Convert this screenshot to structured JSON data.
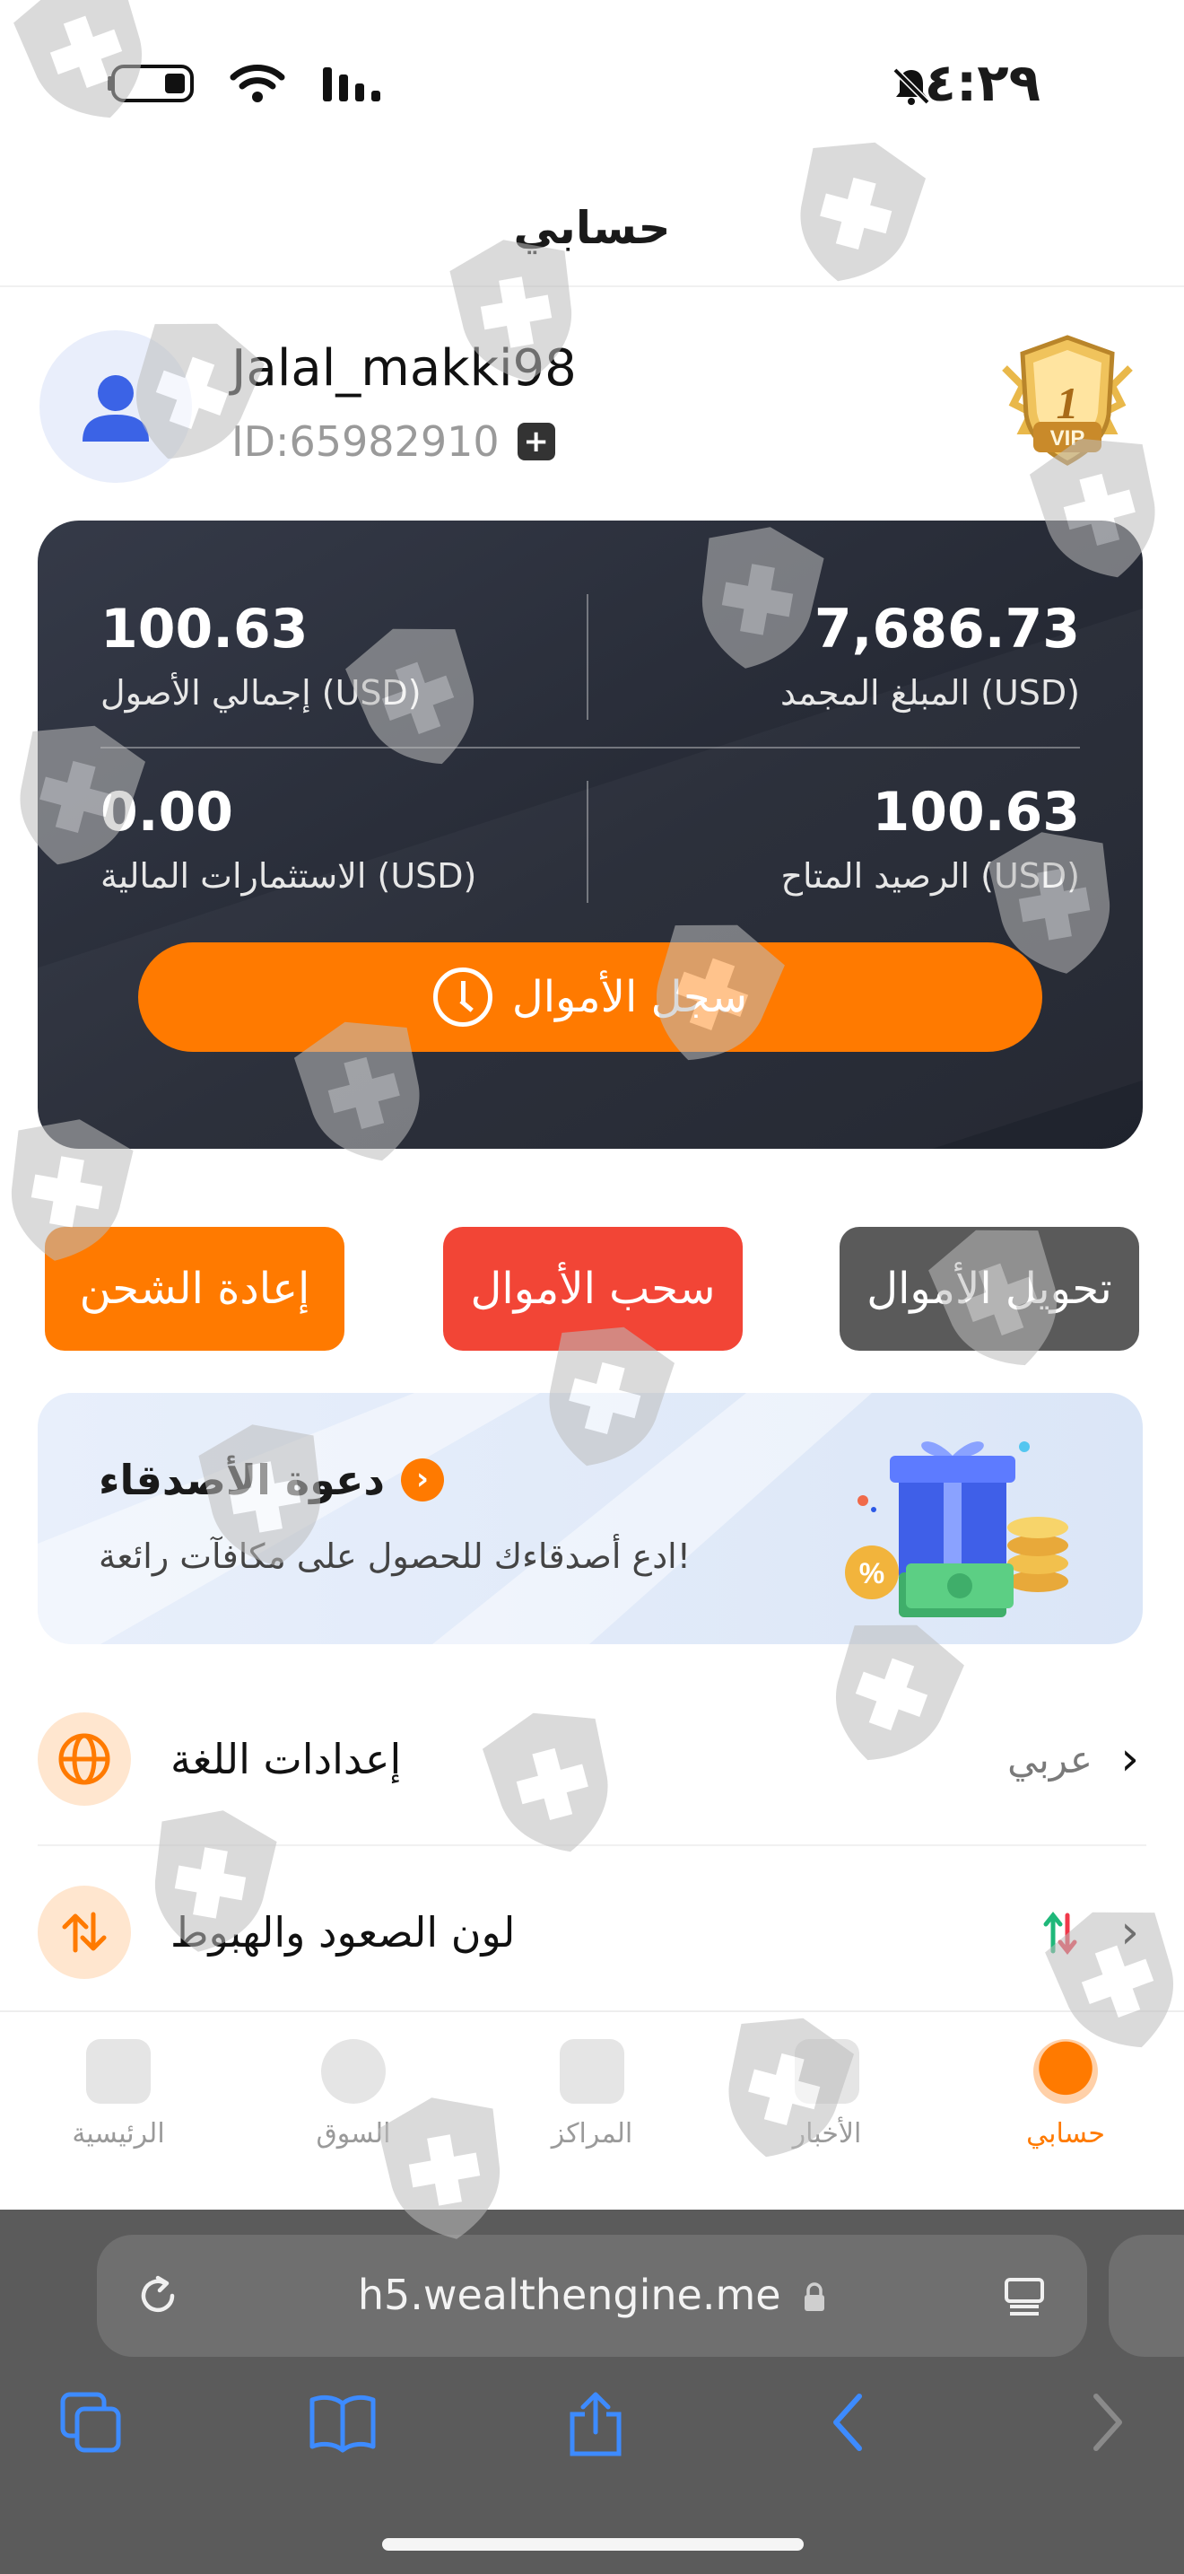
{
  "status_bar": {
    "time": "٤:٢٩"
  },
  "header": {
    "title": "حسابي"
  },
  "profile": {
    "username": "Jalal_makki98",
    "user_id": "ID:65982910",
    "vip_level": "1",
    "vip_text": "VIP"
  },
  "balance_card": {
    "total_assets": {
      "value": "100.63",
      "label": "إجمالي الأصول  (USD)"
    },
    "frozen_amount": {
      "value": "7,686.73",
      "label": "المبلغ المجمد  (USD)"
    },
    "financial_investments": {
      "value": "0.00",
      "label": "الاستثمارات المالية  (USD)"
    },
    "available_balance": {
      "value": "100.63",
      "label": "الرصيد المتاح  (USD)"
    },
    "fund_record_label": "سجل الأموال"
  },
  "actions": {
    "recharge": "إعادة الشحن",
    "withdraw": "سحب الأموال",
    "transfer": "تحويل الأموال"
  },
  "invite": {
    "title": "دعوة الأصدقاء",
    "subtitle": "ادع أصدقاءك للحصول على مكافآت رائعة!"
  },
  "settings": {
    "language": {
      "label": "إعدادات اللغة",
      "value": "عربي"
    },
    "updown_color": {
      "label": "لون الصعود والهبوط"
    }
  },
  "tabbar": {
    "home": "الرئيسية",
    "market": "السوق",
    "positions": "المراكز",
    "news": "الأخبار",
    "account": "حسابي",
    "active": "account"
  },
  "browser": {
    "url": "h5.wealthengine.me"
  },
  "colors": {
    "accent": "#ff7a00",
    "withdraw": "#f24536",
    "transfer": "#5a5a5a",
    "card": "#2a2e39"
  }
}
